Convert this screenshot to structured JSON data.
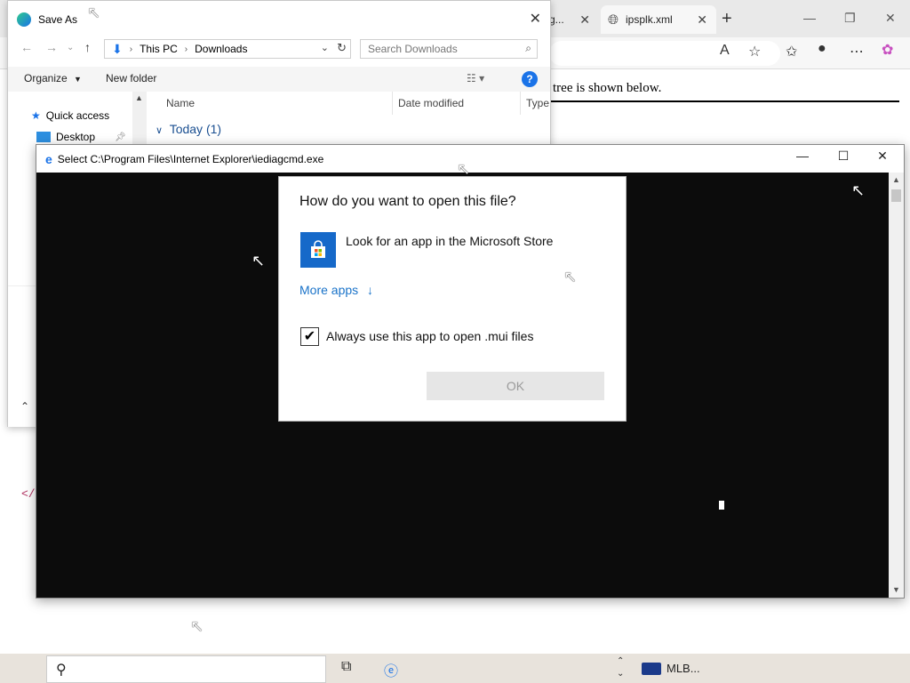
{
  "browser": {
    "tabs": [
      {
        "label": "g..."
      },
      {
        "label": "ipsplk.xml"
      }
    ],
    "content_text": "tree is shown below.",
    "code_fragment": "</"
  },
  "save_as": {
    "title": "Save As",
    "path": [
      "This PC",
      "Downloads"
    ],
    "search_placeholder": "Search Downloads",
    "organize_label": "Organize",
    "new_folder_label": "New folder",
    "nav_items": [
      "Quick access",
      "Desktop"
    ],
    "columns": [
      "Name",
      "Date modified",
      "Type"
    ],
    "group_label": "Today (1)"
  },
  "select_window": {
    "title": "Select C:\\Program Files\\Internet Explorer\\iediagcmd.exe"
  },
  "open_with": {
    "heading": "How do you want to open this file?",
    "store_label": "Look for an app in the Microsoft Store",
    "more_apps_label": "More apps",
    "always_use_label": "Always use this app to open .mui files",
    "always_use_checked": true,
    "ok_label": "OK"
  },
  "taskbar": {
    "news_label": "MLB..."
  },
  "icons": [
    "edge-icon",
    "globe-icon",
    "ie-icon",
    "store-icon",
    "search-icon",
    "help-icon"
  ]
}
